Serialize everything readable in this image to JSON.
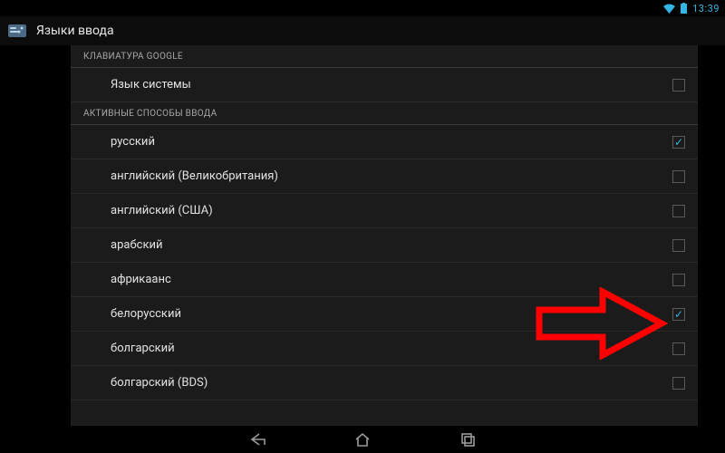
{
  "status_bar": {
    "time": "13:39"
  },
  "action_bar": {
    "title": "Языки ввода"
  },
  "sections": {
    "google_keyboard_header": "КЛАВИАТУРА GOOGLE",
    "system_language_label": "Язык системы",
    "active_input_header": "АКТИВНЫЕ СПОСОБЫ ВВОДА"
  },
  "languages": [
    {
      "label": "русский",
      "checked": true
    },
    {
      "label": "английский (Великобритания)",
      "checked": false
    },
    {
      "label": "английский (США)",
      "checked": false
    },
    {
      "label": "арабский",
      "checked": false
    },
    {
      "label": "африкаанс",
      "checked": false
    },
    {
      "label": "белорусский",
      "checked": true
    },
    {
      "label": "болгарский",
      "checked": false
    },
    {
      "label": "болгарский (BDS)",
      "checked": false
    }
  ]
}
